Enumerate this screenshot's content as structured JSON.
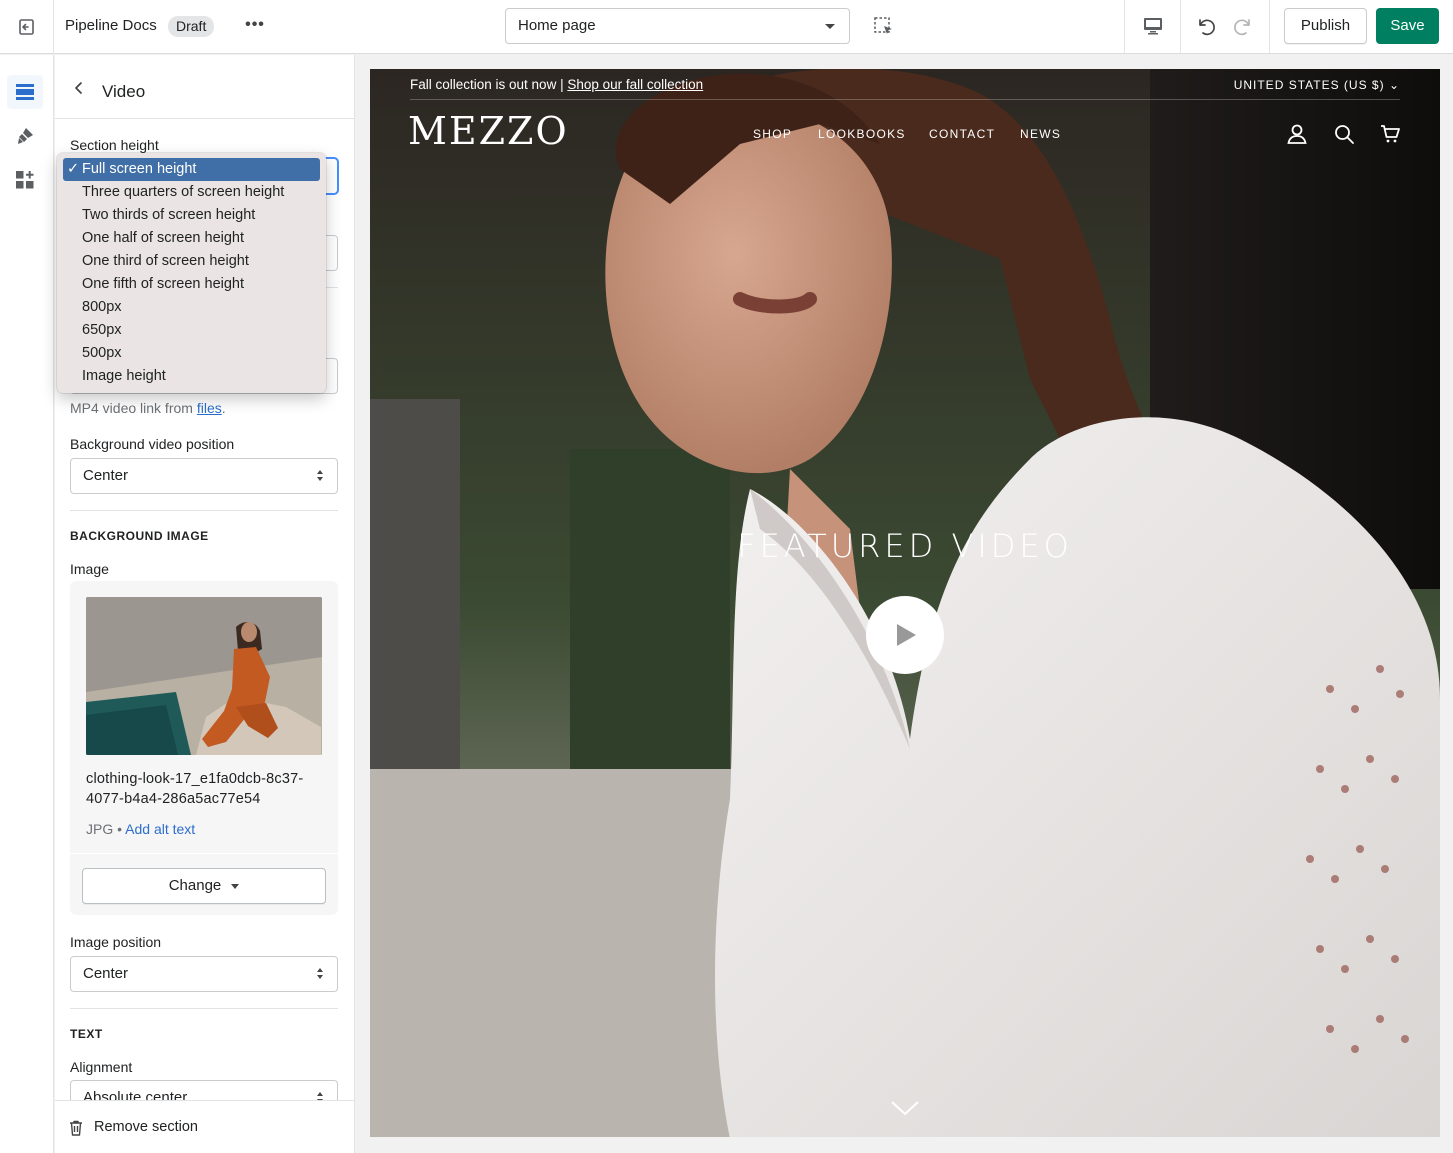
{
  "topbar": {
    "store_name": "Pipeline Docs",
    "status_badge": "Draft",
    "more_label": "•••",
    "page_select": "Home page",
    "publish_label": "Publish",
    "save_label": "Save"
  },
  "panel": {
    "title": "Video",
    "section_height_label": "Section height",
    "section_height_options": [
      "Full screen height",
      "Three quarters of screen height",
      "Two thirds of screen height",
      "One half of screen height",
      "One third of screen height",
      "One fifth of screen height",
      "800px",
      "650px",
      "500px",
      "Image height"
    ],
    "section_height_selected": "Full screen height",
    "video_hint_prefix": "MP4 video link from ",
    "video_hint_link": "files",
    "video_hint_suffix": ".",
    "bg_video_position_label": "Background video position",
    "bg_video_position_value": "Center",
    "background_image_heading": "BACKGROUND IMAGE",
    "image_label": "Image",
    "image_file_name": "clothing-look-17_e1fa0dcb-8c37-4077-b4a4-286a5ac77e54",
    "image_type": "JPG",
    "image_meta_sep": " • ",
    "add_alt_text": "Add alt text",
    "change_label": "Change",
    "image_position_label": "Image position",
    "image_position_value": "Center",
    "text_heading": "TEXT",
    "alignment_label": "Alignment",
    "alignment_value": "Absolute center",
    "remove_section": "Remove section"
  },
  "preview": {
    "announcement_text": "Fall collection is out now | ",
    "announcement_link": "Shop our fall collection",
    "region": "UNITED STATES (US $)",
    "logo": "MEZZO",
    "nav": [
      "SHOP",
      "LOOKBOOKS",
      "CONTACT",
      "NEWS"
    ],
    "heading": "FEATURED VIDEO"
  },
  "icons": {
    "exit": "exit-icon",
    "inspector": "inspector-icon",
    "device": "desktop-icon",
    "undo": "undo-icon",
    "redo": "redo-icon",
    "sections": "sections-icon",
    "theme_settings": "paintbrush-icon",
    "apps": "apps-icon",
    "account": "account-icon",
    "search": "search-icon",
    "cart": "cart-icon",
    "play": "play-icon",
    "chevron_down": "chevron-down-icon",
    "trash": "trash-icon"
  },
  "colors": {
    "save_green": "#008060",
    "link_blue": "#2c6ecb",
    "selected_option": "#3f6fa6",
    "dropdown_bg": "#ebe4e4"
  }
}
